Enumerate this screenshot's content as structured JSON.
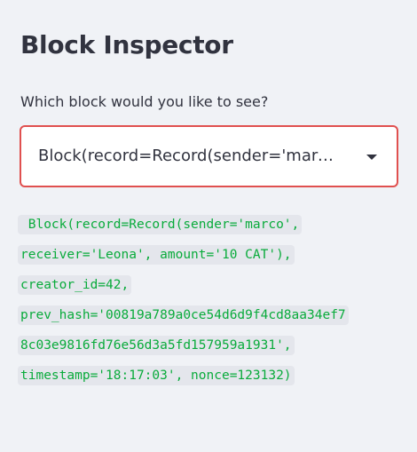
{
  "page": {
    "title": "Block Inspector"
  },
  "block_select": {
    "label": "Which block would you like to see?",
    "selected_value": "Block(record=Record(sender='marc…",
    "icon": "chevron-down-icon"
  },
  "block_output": {
    "lines": [
      " Block(record=Record(sender='marco',",
      "receiver='Leona', amount='10 CAT'),",
      "creator_id=42,",
      "prev_hash='00819a789a0ce54d6d9f4cd8aa34ef7",
      "8c03e9816fd76e56d3a5fd157959a1931',",
      "timestamp='18:17:03', nonce=123132)"
    ]
  },
  "colors": {
    "background": "#f0f2f6",
    "text": "#31333f",
    "select_border_focus": "#e0504f",
    "code_text": "#09ab3b",
    "code_background": "#e4e6ec"
  }
}
